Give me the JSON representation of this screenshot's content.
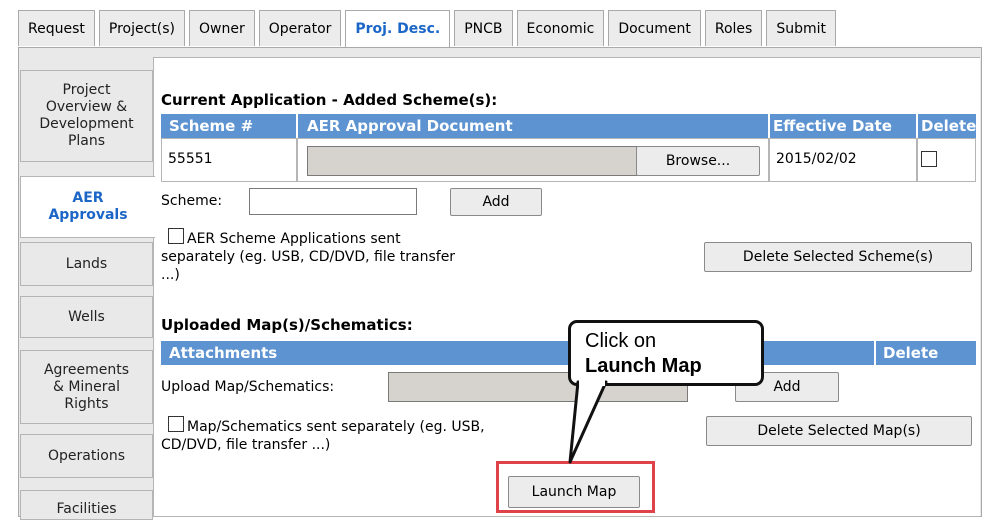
{
  "top_tabs": [
    "Request",
    "Project(s)",
    "Owner",
    "Operator",
    "Proj. Desc.",
    "PNCB",
    "Economic",
    "Document",
    "Roles",
    "Submit"
  ],
  "active_tab": "Proj. Desc.",
  "side_tabs": [
    "Project Overview & Development Plans",
    "AER Approvals",
    "Lands",
    "Wells",
    "Agreements & Mineral Rights",
    "Operations",
    "Facilities"
  ],
  "active_side_tab": "AER Approvals",
  "schemes": {
    "title": "Current Application - Added Scheme(s):",
    "columns": [
      "Scheme #",
      "AER Approval Document",
      "Effective Date",
      "Delete"
    ],
    "rows": [
      {
        "scheme": "55551",
        "browse_label": "Browse...",
        "effective_date": "2015/02/02"
      }
    ],
    "scheme_label": "Scheme:",
    "add_label": "Add",
    "sent_separately": "AER Scheme Applications sent separately (eg. USB, CD/DVD, file transfer ...)",
    "delete_selected": "Delete Selected Scheme(s)"
  },
  "maps": {
    "title": "Uploaded Map(s)/Schematics:",
    "columns": [
      "Attachments",
      "Delete"
    ],
    "upload_label": "Upload Map/Schematics:",
    "add_label": "Add",
    "sent_separately": "Map/Schematics sent separately (eg. USB, CD/DVD, file transfer ...)",
    "delete_selected": "Delete Selected Map(s)",
    "launch_map": "Launch Map"
  },
  "callout": {
    "line1": "Click on",
    "line2": "Launch Map"
  },
  "colors": {
    "header_blue": "#5d93d0",
    "active_tab_text": "#1b66c7",
    "highlight_red": "#e0424a"
  }
}
